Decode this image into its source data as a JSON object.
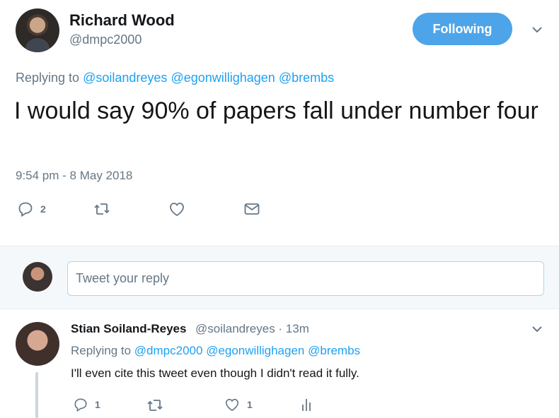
{
  "main_tweet": {
    "author_name": "Richard Wood",
    "author_handle": "@dmpc2000",
    "follow_label": "Following",
    "replying_prefix": "Replying to",
    "replying_to": [
      "@soilandreyes",
      "@egonwillighagen",
      "@brembs"
    ],
    "text": "I would say 90% of papers fall under number four",
    "timestamp": "9:54 pm - 8 May 2018",
    "actions": {
      "reply_count": "2",
      "retweet_count": "",
      "like_count": "",
      "message_count": ""
    }
  },
  "reply_box": {
    "placeholder": "Tweet your reply"
  },
  "reply_tweet": {
    "author_name": "Stian Soiland-Reyes",
    "author_handle": "@soilandreyes · 13m",
    "replying_prefix": "Replying to",
    "replying_to": [
      "@dmpc2000",
      "@egonwillighagen",
      "@brembs"
    ],
    "text": "I'll even cite this tweet even though I didn't read it fully.",
    "actions": {
      "reply_count": "1",
      "retweet_count": "",
      "like_count": "1",
      "analytics_count": ""
    }
  },
  "colors": {
    "accent": "#1da1f2",
    "follow_button": "#4ea4e8",
    "secondary_text": "#657786",
    "divider": "#e6ecf0"
  },
  "icons": [
    "reply-icon",
    "retweet-icon",
    "like-icon",
    "direct-message-icon",
    "analytics-icon",
    "chevron-down-icon"
  ]
}
